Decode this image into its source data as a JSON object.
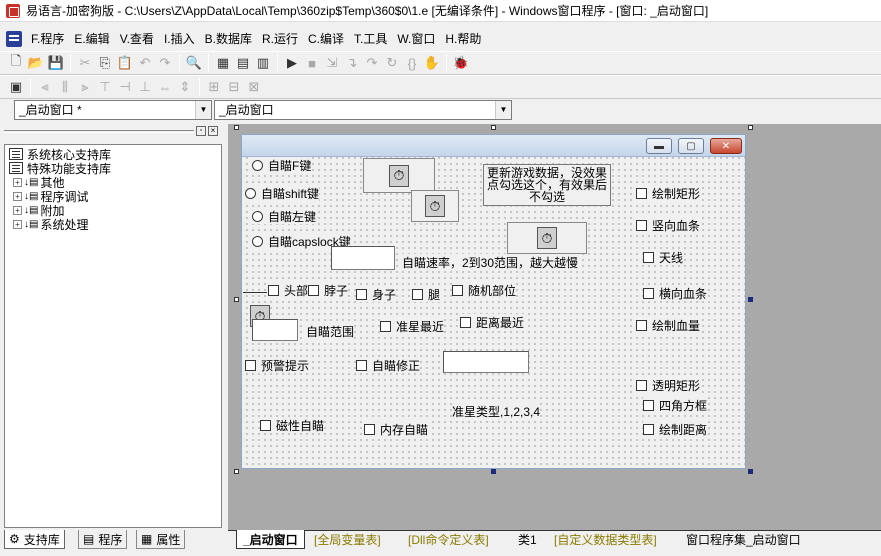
{
  "window": {
    "title": "易语言-加密狗版 - C:\\Users\\Z\\AppData\\Local\\Temp\\360zip$Temp\\360$0\\1.e [无编译条件] - Windows窗口程序 - [窗口: _启动窗口]"
  },
  "menu": [
    "F.程序",
    "E.编辑",
    "V.查看",
    "I.插入",
    "B.数据库",
    "R.运行",
    "C.编译",
    "T.工具",
    "W.窗口",
    "H.帮助"
  ],
  "combos": {
    "left": "_启动窗口 *",
    "right": "_启动窗口"
  },
  "tree": {
    "items": [
      {
        "label": "系统核心支持库",
        "expand": ""
      },
      {
        "label": "特殊功能支持库",
        "expand": ""
      },
      {
        "label": "其他",
        "expand": "+"
      },
      {
        "label": "程序调试",
        "expand": "+"
      },
      {
        "label": "附加",
        "expand": "+"
      },
      {
        "label": "系统处理",
        "expand": "+"
      }
    ]
  },
  "left_tabs": [
    "支持库",
    "程序",
    "属性"
  ],
  "bottom_tabs": [
    "_启动窗口",
    "[全局变量表]",
    "[Dll命令定义表]",
    "类1",
    "[自定义数据类型表]",
    "窗口程序集_启动窗口"
  ],
  "form": {
    "radios": [
      "自瞄F键",
      "自瞄shift键",
      "自瞄左键",
      "自瞄capslock键"
    ],
    "checks": {
      "head": "头部",
      "neck": "脖子",
      "body": "身子",
      "leg": "腿",
      "random": "随机部位",
      "nearest_star": "准星最近",
      "nearest_dist": "距离最近",
      "warn": "预警提示",
      "correct": "自瞄修正",
      "magnet": "磁性自瞄",
      "memory": "内存自瞄",
      "rect": "绘制矩形",
      "vbar": "竖向血条",
      "sky": "天线",
      "hbar": "横向血条",
      "hp": "绘制血量",
      "trect": "透明矩形",
      "corners": "四角方框",
      "dist": "绘制距离"
    },
    "labels": {
      "speed": "自瞄速率，2到30范围，越大越慢",
      "range": "自瞄范围",
      "star_type": "准星类型,1,2,3,4"
    },
    "button": "更新游戏数据，没效果点勾选这个，有效果后不勾选"
  },
  "icons": {
    "timer": "stopwatch-icon"
  }
}
